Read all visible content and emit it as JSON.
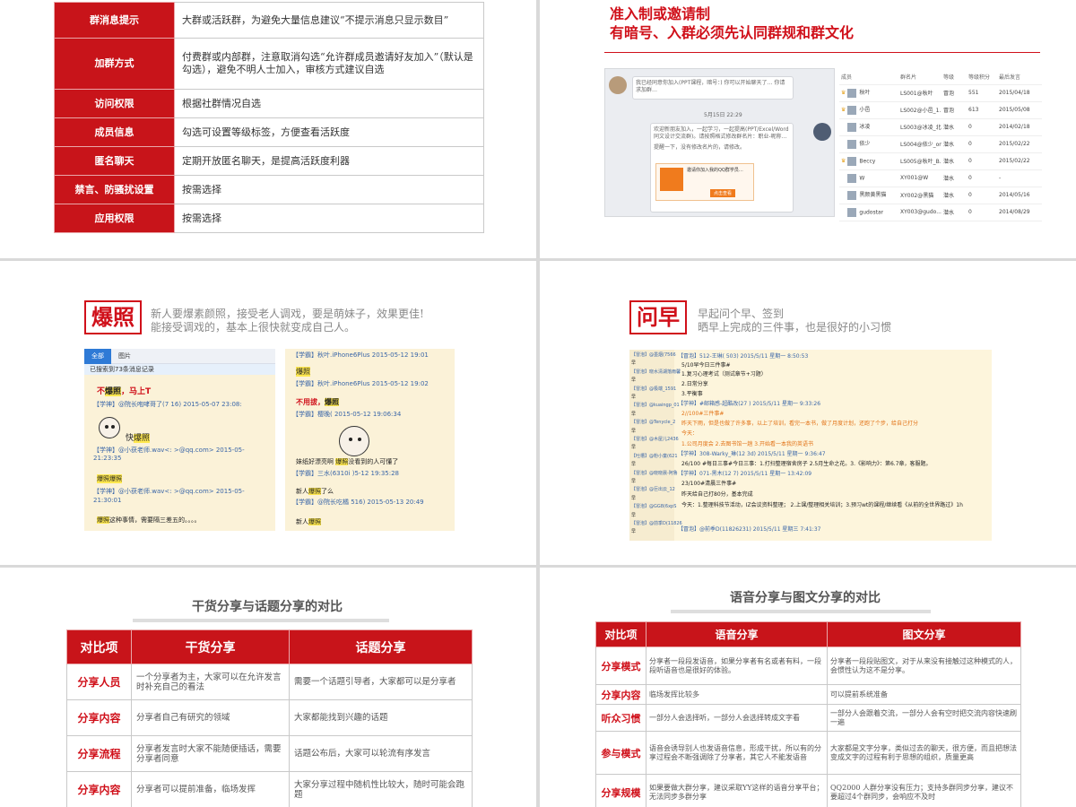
{
  "slide1": {
    "rows": [
      {
        "k": "群消息提示",
        "v": "大群或活跃群，为避免大量信息建议“不提示消息只显示数目”"
      },
      {
        "k": "加群方式",
        "v": "付费群或内部群，注意取消勾选“允许群成员邀请好友加入”（默认是勾选），避免不明人士加入，审核方式建议自选"
      },
      {
        "k": "访问权限",
        "v": "根据社群情况自选"
      },
      {
        "k": "成员信息",
        "v": "勾选可设置等级标签，方便查看活跃度"
      },
      {
        "k": "匿名聊天",
        "v": "定期开放匿名聊天，是提高活跃度利器"
      },
      {
        "k": "禁言、防骚扰设置",
        "v": "按需选择"
      },
      {
        "k": "应用权限",
        "v": "按需选择"
      }
    ]
  },
  "slide2": {
    "title_a": "准入制或邀请制",
    "title_b": "有暗号、入群必须先认同群规和群文化",
    "chat": {
      "msg1": "我已经同意你加入(PPT课程，暗号：) 你可以开始聊天了…    你请求加群…",
      "time": "5月15日 22:29",
      "msg2": "欢迎新朋友加入，一起学习，一起提高(PPT/Excel/Word同文设计交流群)。请按照格式修改群名片：职业-昵称…",
      "msg3": "提醒一下，没有修改名片的，请修改。",
      "card_title": "邀请你加入我的QQ群学员…",
      "card_btn": "点击查看"
    },
    "members": {
      "headers": [
        "成员",
        "群名片",
        "等级",
        "等级积分",
        "最后发言"
      ],
      "rows": [
        {
          "name": "秋叶",
          "card": "LS001@秋叶",
          "lv": "冒泡",
          "pts": "551",
          "date": "2015/04/18",
          "crown": true
        },
        {
          "name": "小邑",
          "card": "LS002@小邑_1...",
          "lv": "冒泡",
          "pts": "613",
          "date": "2015/05/08",
          "crown": true
        },
        {
          "name": "冰凌",
          "card": "LS003@冰凌_北...",
          "lv": "潜水",
          "pts": "0",
          "date": "2014/02/18",
          "crown": false
        },
        {
          "name": "依少",
          "card": "LS004@依少_on",
          "lv": "潜水",
          "pts": "0",
          "date": "2015/02/22",
          "crown": false
        },
        {
          "name": "Beccy",
          "card": "LS005@秋叶_B...",
          "lv": "潜水",
          "pts": "0",
          "date": "2015/02/22",
          "crown": true
        },
        {
          "name": "W",
          "card": "XY001@W",
          "lv": "潜水",
          "pts": "0",
          "date": "-",
          "crown": false
        },
        {
          "name": "黑颜黄黑猫",
          "card": "XY002@黑猫",
          "lv": "潜水",
          "pts": "0",
          "date": "2014/05/16",
          "crown": false
        },
        {
          "name": "gudostar",
          "card": "XY003@gudo...",
          "lv": "潜水",
          "pts": "0",
          "date": "2014/08/29",
          "crown": false
        }
      ]
    }
  },
  "slide3": {
    "tag": "爆照",
    "desc1": "新人要爆素颜照，接受老人调戏，要是萌妹子，效果更佳!",
    "desc2": "能接受调戏的，基本上很快就变成自己人。",
    "shotL": {
      "tab_all": "全部",
      "tab_img": "图片",
      "info": "已搜索到73条消息记录",
      "l1_pre": "不",
      "l1_hl": "爆照",
      "l1_post": "，马上T",
      "l2": "【学神】@院长咆哮哥了(7          16) 2015-05-07 23:08:",
      "l3_pre": "快",
      "l3_hl": "爆照",
      "l4": "【学神】@小获老师.wav<:            >@qq.com> 2015-05-",
      "l5": "21:23:35",
      "l6": "爆照爆照",
      "l7": "【学神】@小获老师.wav<:            >@qq.com> 2015-05-",
      "l8": "21:30:01",
      "l9_hl": "爆照",
      "l9_post": "这种事情，需要隔三差五的。。。。"
    },
    "shotR": {
      "r1a": "【学霸】秋叶.iPhone6Plus           2015-05-12 19:01",
      "r1b": "爆照",
      "r2a": "【学霸】秋叶.iPhone6Plus           2015-05-12 19:02",
      "r2b_pre": "不用拔，",
      "r2b_hl": "爆照",
      "r3": "【学霸】樱晚(              2015-05-12 19:06:34",
      "r4_pre": "妹纸好漂亮啊 ",
      "r4_hl": "爆照",
      "r4_post": "没看到的人可懂了",
      "r5": "【学霸】三水(6310i           )5-12 19:35:28",
      "r6_pre": "新人",
      "r6_hl": "爆照",
      "r6_post": "了么",
      "r7": "【学霸】@院长吃橘           516) 2015-05-13 20:49",
      "r8_pre": "新人",
      "r8_hl": "爆照"
    }
  },
  "slide4": {
    "tag": "问早",
    "desc1": "早起问个早、签到",
    "desc2": "晒早上完成的三件事，也是很好的小习惯",
    "shot": {
      "left": [
        "【冒泡】@墨烟(7566",
        "早",
        "【冒泡】晓水清湖落雨馨",
        "早",
        "【冒泡】@极端_1591",
        "早",
        "【冒泡】@kuaingp_01",
        "早",
        "【冒泡】@Tenycle_2",
        "早",
        "【冒泡】@木屋儿2436",
        "早",
        "【吐槽】@粉小童(621",
        "早",
        "【冒泡】@晓晓晨-阿鲁",
        "早",
        "【冒泡】@巨出云_12",
        "早",
        "【冒泡】@GG8(6xpS",
        "早",
        "【冒泡】@前季D(11826",
        "早"
      ],
      "r1": "【冒泡】512-王琳(          503) 2015/5/11 星期一 8:50:53",
      "r2": "5/10早今日三件事#",
      "r3": "1.复习心理考试（测试章节+习题）",
      "r4": "2.日常分享",
      "r5": "3.平衡事",
      "r6": "【学神】#邮箱感-超酷改(27           ) 2015/5/11 星期一 9:33:26",
      "r7": "2//100#三件事#",
      "r8": "昨天下雨，但是也做了许多事，以上了培训，看完一本书，做了月度计划，还跑了个步，给自己打分",
      "r9": "今天：",
      "r10": "1.公司月度会  2.去图书馆一趟  3.开始看一本我的英语书",
      "r11": "【学神】308-Warky_琳(12          3d) 2015/5/11 星期一 9:36:47",
      "r12": "26/100 #每日三事#今日三事：1.打扫整理宿舍房子 2.5月生命之花。3.《影响力》：第6.7章，客服题。",
      "r13": "【学神】071-黑木(12          7) 2015/5/11 星期一 13:42:09",
      "r14": "23/100#清晨三件事#",
      "r15": "昨天给自己打80分，基本完成",
      "r16": "今天：1.整理科技节活动，IZ会议资料整理； 2.上课/整理相关培训；3.预习wt的课程/继续看《从前的全世界路过》1h",
      "r17": "【冒泡】@前季D(11826231) 2015/5/11 星期三 7:41:37"
    }
  },
  "slide5": {
    "title": "干货分享与话题分享的对比",
    "headers": [
      "对比项",
      "干货分享",
      "话题分享"
    ],
    "rows": [
      {
        "k": "分享人员",
        "a": "一个分享者为主，大家可以在允许发言时补充自己的看法",
        "b": "需要一个话题引导者，大家都可以是分享者"
      },
      {
        "k": "分享内容",
        "a": "分享者自己有研究的领域",
        "b": "大家都能找到兴趣的话题"
      },
      {
        "k": "分享流程",
        "a": "分享者发言时大家不能随便插话，需要分享者同意",
        "b": "话题公布后，大家可以轮流有序发言"
      },
      {
        "k": "分享内容",
        "a": "分享者可以提前准备，临场发挥",
        "b": "大家分享过程中随机性比较大，随时可能会跑题"
      }
    ]
  },
  "slide6": {
    "title": "语音分享与图文分享的对比",
    "headers": [
      "对比项",
      "语音分享",
      "图文分享"
    ],
    "rows": [
      {
        "k": "分享模式",
        "a": "分享者一段段发语音，如果分享者有名或者有料，一段段听语音也是很好的体验。",
        "b": "分享者一段段贴图文，对于从来没有接触过这种模式的人，会惯性认为这不是分享。"
      },
      {
        "k": "分享内容",
        "a": "临场发挥比较多",
        "b": "可以提前系统准备"
      },
      {
        "k": "听众习惯",
        "a": "一部分人会选择听，一部分人会选择转成文字看",
        "b": "一部分人会跟着交流，一部分人会有空时把交流内容快速刷一遍"
      },
      {
        "k": "参与模式",
        "a": "语音会诱导别人也发语音信息，形成干扰，所以有的分享过程会不断强调除了分享者，其它人不能发语音",
        "b": "大家都是文字分享，类似过去的聊天，很方便，而且把想法变成文字的过程有利于思想的组织，质量更高"
      },
      {
        "k": "分享规模",
        "a": "如果要做大群分享，建议采取YY这样的语音分享平台；无法同步多群分享",
        "b": "QQ2000 人群分享没有压力；支持多群同步分享，建议不要超过4个群同步，会响应不及时"
      }
    ]
  }
}
